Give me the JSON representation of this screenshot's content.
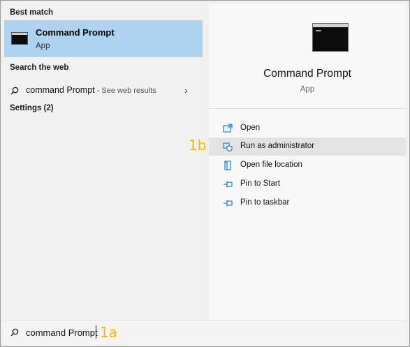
{
  "left_panel": {
    "best_match_header": "Best match",
    "best_match": {
      "title": "Command Prompt",
      "subtitle": "App",
      "icon": "terminal-icon"
    },
    "search_web_header": "Search the web",
    "web_result": {
      "query": "command Prompt",
      "suffix": " - See web results",
      "icon": "search-icon"
    },
    "settings_header": "Settings (2)"
  },
  "right_panel": {
    "app_title": "Command Prompt",
    "app_subtitle": "App",
    "actions": [
      {
        "label": "Open",
        "icon": "open-icon"
      },
      {
        "label": "Run as administrator",
        "icon": "shield-icon"
      },
      {
        "label": "Open file location",
        "icon": "folder-icon"
      },
      {
        "label": "Pin to Start",
        "icon": "pin-icon"
      },
      {
        "label": "Pin to taskbar",
        "icon": "pin-icon"
      }
    ]
  },
  "annotations": {
    "a": "1a",
    "b": "1b"
  },
  "search_box": {
    "value": "command Prompt"
  },
  "colors": {
    "selected": "#add3f1",
    "hover": "#e3e3e3",
    "accent": "#0078d7",
    "annotation": "#ffb300"
  }
}
